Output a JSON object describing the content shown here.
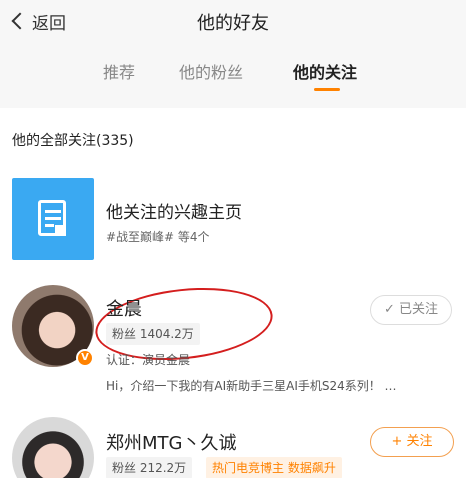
{
  "header": {
    "back_label": "返回",
    "title": "他的好友"
  },
  "tabs": [
    {
      "label": "推荐",
      "active": false
    },
    {
      "label": "他的粉丝",
      "active": false
    },
    {
      "label": "他的关注",
      "active": true
    }
  ],
  "section": {
    "title": "他的全部关注(335)"
  },
  "interest": {
    "name": "他关注的兴趣主页",
    "sub": "#战至巅峰#  等4个",
    "icon": "document-icon"
  },
  "users": [
    {
      "name": "金晨",
      "fans": "粉丝 1404.2万",
      "verify": "认证：演员金晨",
      "intro": "Hi，介绍一下我的有AI新助手三星AI手机S24系列！ …",
      "badge": "V",
      "follow_state": "✓ 已关注"
    },
    {
      "name": "郑州MTG丶久诚",
      "fans": "粉丝 212.2万",
      "tag": "热门电竞博主  数据飙升",
      "follow_state": "+ 关注"
    }
  ],
  "colors": {
    "accent": "#ff8200",
    "annotation": "#d41e1e",
    "interest_bg": "#3aa9f2"
  }
}
